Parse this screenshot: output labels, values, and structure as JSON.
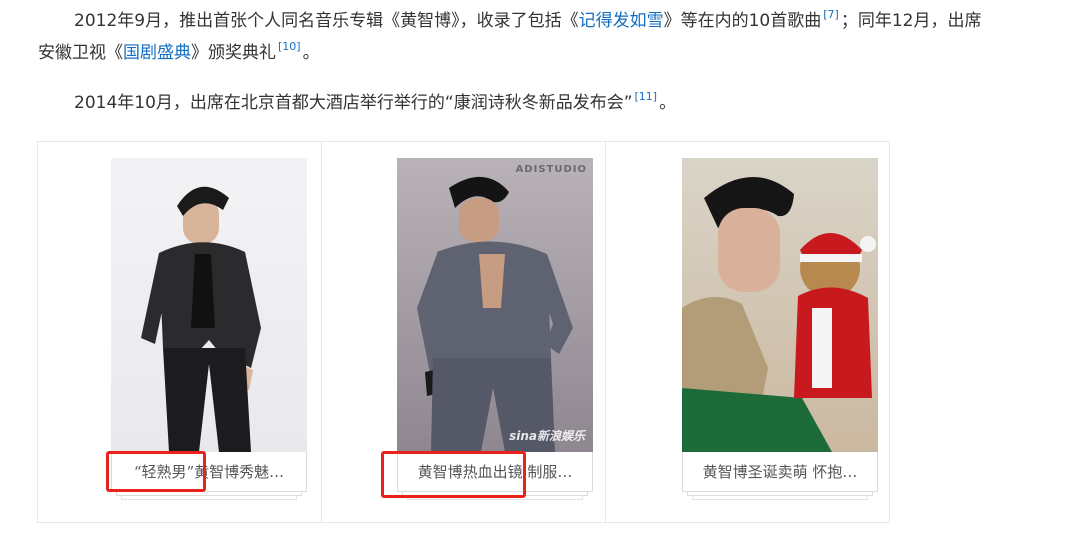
{
  "paragraph1": {
    "line1_a": "2012年9月，推出首张个人同名音乐专辑《黄智博》，收录了包括《",
    "link_song": "记得发如雪",
    "line1_b": "》等在内的10首歌曲",
    "ref1": "[7]",
    "line1_c": "；同年12月，出席",
    "line2_a": "安徽卫视《",
    "link_show": "国剧盛典",
    "line2_b": "》颁奖典礼",
    "ref2": "[10]",
    "line2_c": "。"
  },
  "paragraph2": {
    "text": "2014年10月，出席在北京首都大酒店举行举行的“康润诗秋冬新品发布会”",
    "ref": "[11]",
    "end": "。"
  },
  "album": {
    "items": [
      {
        "caption": "“轻熟男”黄智博秀魅…"
      },
      {
        "caption": "黄智博热血出镜 制服…",
        "watermark_top": "ADISTUDIO",
        "watermark_bottom": "sina新浪娱乐"
      },
      {
        "caption": "黄智博圣诞卖萌 怀抱…"
      }
    ]
  },
  "colors": {
    "link": "#136ec2",
    "highlight": "#e8231c"
  }
}
